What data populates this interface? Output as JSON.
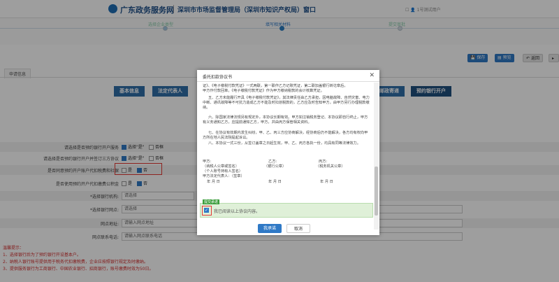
{
  "header": {
    "brand": "广东政务服务网",
    "office": "深圳市市场监督管理局（深圳市知识产权局）窗口",
    "user": "1号测试用户"
  },
  "progress": {
    "steps": [
      "选择企业类型",
      "填写相关材料",
      "提交审批"
    ]
  },
  "toolbar": {
    "save": "保存",
    "preview": "预览",
    "back": "返回"
  },
  "tabs": {
    "apply_info": "申请信息"
  },
  "section_nav": [
    "基本信息",
    "法定代表人",
    "邮政寄递",
    "预约银行开户"
  ],
  "form": {
    "q1": {
      "label": "请选择是否预约银行开户服务",
      "yes": "选择\"是\"",
      "no": "否框"
    },
    "q2": {
      "label": "请选择是否预约银行开户并签订三方协议",
      "yes": "选择\"是\"",
      "no": "否框"
    },
    "q3": {
      "label": "是否同意预约开户账户代扣税费和社保",
      "no": "是",
      "yes": "否"
    },
    "q4": {
      "label": "是否使用预约开户代扣缴费公积金",
      "no": "是",
      "yes": "否"
    },
    "bank": {
      "label": "*选择银行机构:",
      "placeholder": "请选择"
    },
    "branch": {
      "label": "*选择银行网点:",
      "placeholder": "请选择"
    },
    "site_addr": {
      "label": "网点地址:",
      "placeholder": "请输入网点地址"
    },
    "site_phone": {
      "label": "网点联系电话:",
      "placeholder": "请输入网点联系电话"
    }
  },
  "notes": {
    "title": "温馨提示：",
    "items": [
      "1、选择银行后为了预约银行开设基本户。",
      "2、纳税人银行账号提供用于税务代扣缴税费，企业应按照银行规定及时缴纳。",
      "3、提供服务银行为工商银行、中国农业银行、招商银行，账号缴费时效为50日。"
    ]
  },
  "modal": {
    "title": "委托扣款协议书",
    "paragraphs": [
      "证》、《电子缴税付款凭证》一式两联，第一联作乙方记账凭证，第二联加盖银行转讫章后，",
      "甲方作付款回单。《电子缴税付款凭证》作为甲方缴纳税款的会计核算凭证。",
      "五、乙方未能履行开具《电子缴税付款凭证》，其法律责任由乙方承担，因电脑故障、自然灾害、电力中断、通讯故障等不可抗力造成乙方不能及时扣划税款的，乙方应及时告知甲方，由甲方另行办理税款缴纳。",
      "六、除国家法律法规另有规定外，本协议长期有效。甲方如注销税务登记、本协议即自行终止，甲方有义务通知乙方，应提前通知乙方，甲方，并由丙方保管相关资料。",
      "七、在协议有效期内发生纠纷，甲、乙、丙三方应协商解决，经协商后仍不能解决，各方均有权向甲方所在地人民法院提起诉讼。",
      "八、本协议一式三份，从签订盖章之日起生效，甲、乙、丙方各执一份，均具有同等法律效力。"
    ],
    "sig": {
      "party_a": "甲方:",
      "party_b": "乙方:",
      "party_c": "丙方:",
      "a_seal": "（纳税人公章或签名）",
      "b_seal": "（银行公章）",
      "c_seal": "（税务机关公章）",
      "a_personal": "（个人账号持有人签名）",
      "a_rep": "甲方法定代表人：（签章）",
      "date": "年    月    日"
    },
    "agree_tag": "提交承诺",
    "agree_text": "我已阅读以上协议内容。",
    "ok": "我承诺",
    "cancel": "取消"
  }
}
